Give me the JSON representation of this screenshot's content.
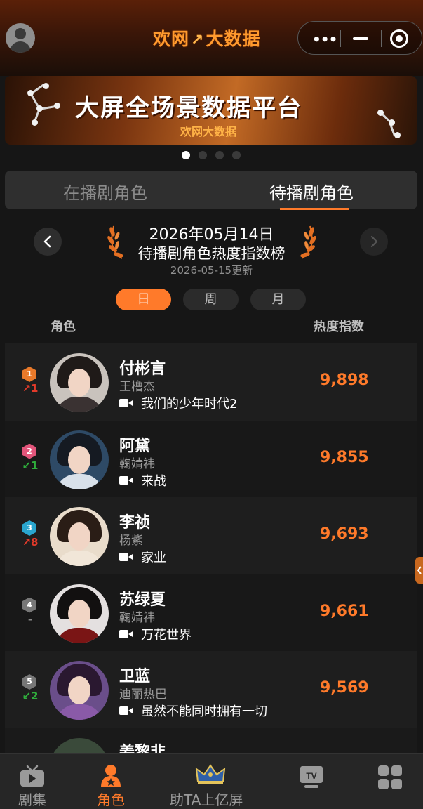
{
  "header": {
    "brand_part1": "欢网",
    "brand_part2": "大数据",
    "menu_dots": "•••"
  },
  "banner": {
    "title": "大屏全场景数据平台",
    "subtitle": "欢网大数据",
    "pages": 4,
    "active_page": 1
  },
  "tabs": {
    "left": "在播剧角色",
    "right": "待播剧角色",
    "active": "right"
  },
  "ranking": {
    "date": "2026年05月14日",
    "board_title": "待播剧角色热度指数榜",
    "updated": "2026-05-15更新",
    "periods": [
      "日",
      "周",
      "月"
    ],
    "active_period": "日",
    "col_role": "角色",
    "col_index": "热度指数"
  },
  "rows": [
    {
      "rank": "1",
      "trend": "↗1",
      "trend_dir": "up",
      "name": "付彬言",
      "actor": "王橹杰",
      "drama": "我们的少年时代2",
      "score": "9,898",
      "rank_color": "#e8792a"
    },
    {
      "rank": "2",
      "trend": "↙1",
      "trend_dir": "down",
      "name": "阿黛",
      "actor": "鞠婧祎",
      "drama": "来战",
      "score": "9,855",
      "rank_color": "#e2557a"
    },
    {
      "rank": "3",
      "trend": "↗8",
      "trend_dir": "up",
      "name": "李祯",
      "actor": "杨紫",
      "drama": "家业",
      "score": "9,693",
      "rank_color": "#2aa6cf"
    },
    {
      "rank": "4",
      "trend": "-",
      "trend_dir": "flat",
      "name": "苏绿夏",
      "actor": "鞠婧祎",
      "drama": "万花世界",
      "score": "9,661",
      "rank_color": "#777777"
    },
    {
      "rank": "5",
      "trend": "↙2",
      "trend_dir": "down",
      "name": "卫蓝",
      "actor": "迪丽热巴",
      "drama": "虽然不能同时拥有一切",
      "score": "9,569",
      "rank_color": "#777777"
    }
  ],
  "partial_row": {
    "name": "姜黎非"
  },
  "bottom_nav": {
    "item1": "剧集",
    "item2": "角色",
    "item3": "助TA上亿屏",
    "item4_badge": "TV",
    "active": "角色"
  }
}
